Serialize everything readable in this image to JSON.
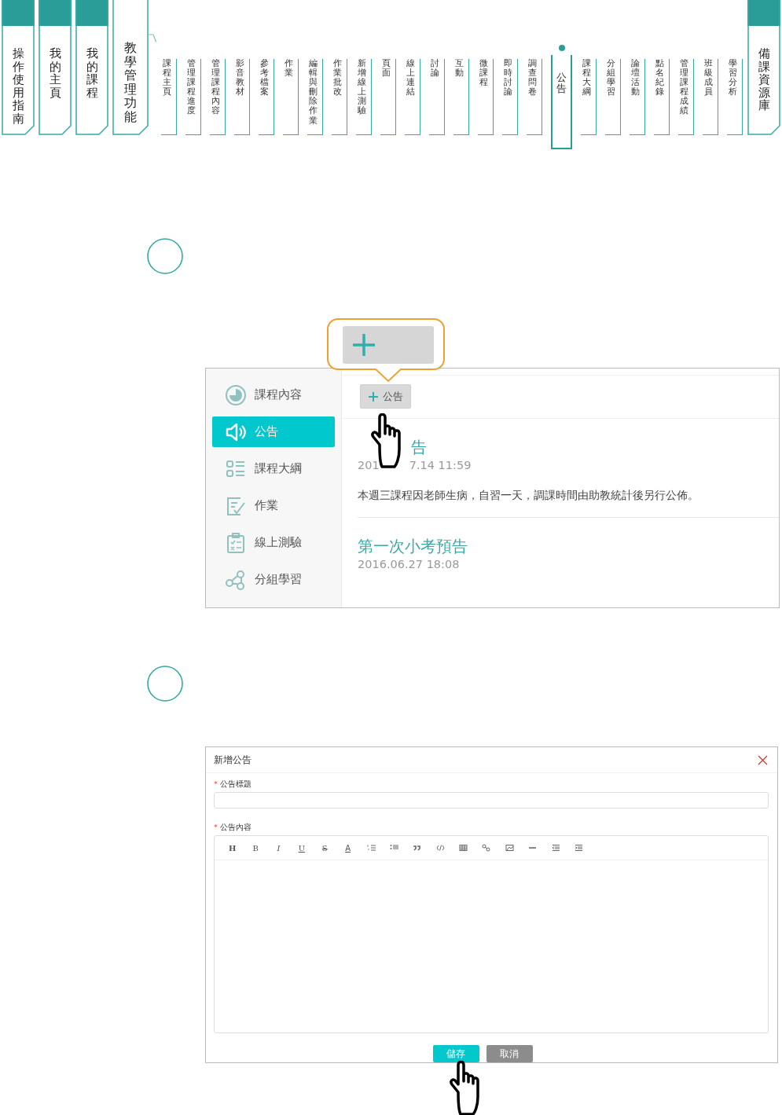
{
  "nav": {
    "left_tabs": [
      {
        "label": "操作使用指南",
        "selected": false
      },
      {
        "label": "我的主頁",
        "selected": false
      },
      {
        "label": "我的課程",
        "selected": false
      },
      {
        "label": "教學管理功能",
        "selected": true
      }
    ],
    "sub_tabs": [
      {
        "label": "課程主頁",
        "selected": false
      },
      {
        "label": "管理課程進度",
        "selected": false
      },
      {
        "label": "管理課程內容",
        "selected": false
      },
      {
        "label": "影音教材",
        "selected": false
      },
      {
        "label": "參考檔案",
        "selected": false
      },
      {
        "label": "作業",
        "selected": false
      },
      {
        "label": "編輯與刪除作業",
        "selected": false
      },
      {
        "label": "作業批改",
        "selected": false
      },
      {
        "label": "新增線上測驗",
        "selected": false
      },
      {
        "label": "頁面",
        "selected": false
      },
      {
        "label": "線上連結",
        "selected": false
      },
      {
        "label": "討論",
        "selected": false
      },
      {
        "label": "互動",
        "selected": false
      },
      {
        "label": "微課程",
        "selected": false
      },
      {
        "label": "即時討論",
        "selected": false
      },
      {
        "label": "調查問卷",
        "selected": false
      },
      {
        "label": "公告",
        "selected": true
      },
      {
        "label": "課程大綱",
        "selected": false
      },
      {
        "label": "分組學習",
        "selected": false
      },
      {
        "label": "論壇活動",
        "selected": false
      },
      {
        "label": "點名紀錄",
        "selected": false
      },
      {
        "label": "管理課程成績",
        "selected": false
      },
      {
        "label": "班級成員",
        "selected": false
      },
      {
        "label": "學習分析",
        "selected": false
      }
    ],
    "right_tabs": [
      {
        "label": "備課資源庫",
        "selected": false
      }
    ]
  },
  "course_screen": {
    "sidebar": [
      {
        "label": "課程內容",
        "kind": "progress",
        "selected": false
      },
      {
        "label": "公告",
        "kind": "megaphone",
        "selected": true
      },
      {
        "label": "課程大綱",
        "kind": "outline",
        "selected": false
      },
      {
        "label": "作業",
        "kind": "edit",
        "selected": false
      },
      {
        "label": "線上測驗",
        "kind": "checklist",
        "selected": false
      },
      {
        "label": "分組學習",
        "kind": "group",
        "selected": false
      }
    ],
    "add_button": {
      "label": "公告"
    },
    "posts": [
      {
        "title_fragments": [
          "告"
        ],
        "date_fragments": [
          "201",
          "7.14 11:59"
        ],
        "body": "本週三課程因老師生病，自習一天，調課時間由助教統計後另行公佈。"
      },
      {
        "title": "第一次小考預告",
        "date": "2016.06.27 18:08"
      }
    ]
  },
  "dialog": {
    "title": "新增公告",
    "fields": [
      {
        "required_mark": "*",
        "label": "公告標題",
        "kind": "input"
      },
      {
        "required_mark": "*",
        "label": "公告內容",
        "kind": "editor"
      }
    ],
    "toolbar": [
      {
        "kind": "heading",
        "glyph": "H"
      },
      {
        "kind": "bold",
        "glyph": "B"
      },
      {
        "kind": "italic",
        "glyph": "I"
      },
      {
        "kind": "underline",
        "glyph": "U"
      },
      {
        "kind": "strike",
        "glyph": "S"
      },
      {
        "kind": "color",
        "glyph": "A"
      },
      {
        "kind": "ordered-list"
      },
      {
        "kind": "bullet-list"
      },
      {
        "kind": "quote"
      },
      {
        "kind": "code"
      },
      {
        "kind": "table"
      },
      {
        "kind": "link"
      },
      {
        "kind": "image"
      },
      {
        "kind": "rule"
      },
      {
        "kind": "outdent"
      },
      {
        "kind": "indent"
      }
    ],
    "buttons": [
      {
        "label": "儲存",
        "kind": "primary"
      },
      {
        "label": "取消",
        "kind": "secondary"
      }
    ]
  }
}
